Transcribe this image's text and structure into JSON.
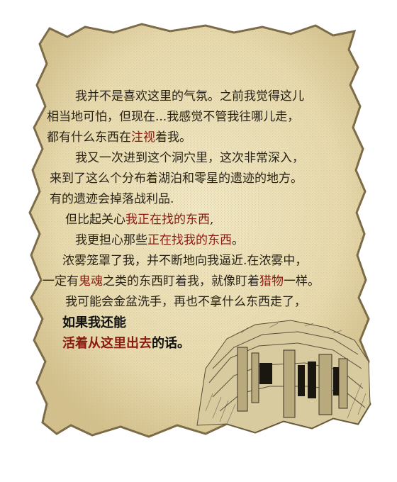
{
  "note": {
    "lines": [
      [
        "我并不是喜欢这里的气氛。之前我觉得这儿"
      ],
      [
        "相当地可怕，但现在...我感觉不管我往哪儿走，"
      ],
      [
        "都有什么东西在",
        "注视",
        "着我。"
      ],
      [
        "我又一次进到这个洞穴里，这次非常深入，"
      ],
      [
        "来到了这么个分布着湖泊和零星的遗迹的地方。"
      ],
      [
        "有的遗迹会掉落战利品."
      ],
      [
        "但比起关心",
        "我正在找的东西",
        ","
      ],
      [
        "我更担心那些",
        "正在找我的东西",
        "。"
      ],
      [
        "浓雾笼罩了我，并不断地向我逼近.在浓雾中，"
      ],
      [
        "一定有",
        "鬼魂",
        "之类的东西盯着我，就像盯着",
        "猎物",
        "一样。"
      ],
      [
        "我可能会金盆洗手，再也不拿什么东西走了，"
      ]
    ],
    "closing": [
      [
        "如果我还能"
      ],
      [
        "活着从这里出去",
        "的话。"
      ]
    ]
  },
  "colors": {
    "parchment": "#e8dcb2",
    "ink": "#2a2418",
    "highlight": "#8a1a12"
  },
  "illustration": "cave-ruins-sketch"
}
